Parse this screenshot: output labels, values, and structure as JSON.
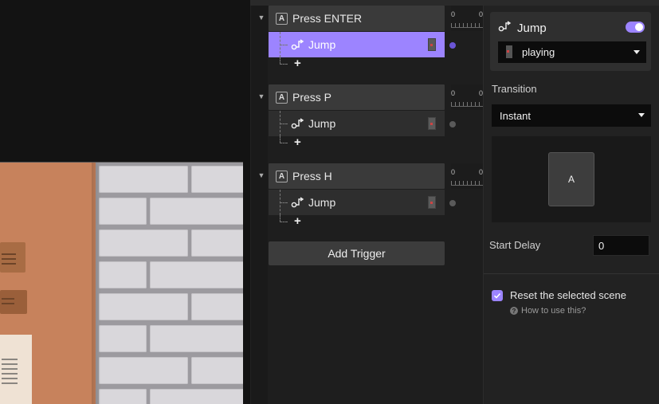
{
  "triggers": [
    {
      "key_badge": "A",
      "title": "Press ENTER",
      "tick_start": "0",
      "tick_next": "0",
      "action": {
        "label": "Jump",
        "selected": true
      },
      "add_label": "+"
    },
    {
      "key_badge": "A",
      "title": "Press P",
      "tick_start": "0",
      "tick_next": "0",
      "action": {
        "label": "Jump",
        "selected": false
      },
      "add_label": "+"
    },
    {
      "key_badge": "A",
      "title": "Press H",
      "tick_start": "0",
      "tick_next": "0",
      "action": {
        "label": "Jump",
        "selected": false
      },
      "add_label": "+"
    }
  ],
  "add_trigger_label": "Add Trigger",
  "properties": {
    "action_title": "Jump",
    "enabled": true,
    "state_value": "playing",
    "transition_label": "Transition",
    "transition_value": "Instant",
    "preview_letter": "A",
    "start_delay_label": "Start Delay",
    "start_delay_value": "0",
    "reset_label": "Reset the selected scene",
    "reset_checked": true,
    "help_link": "How to use this?"
  },
  "colors": {
    "accent": "#9c84ff",
    "active_dot": "#6b55d6"
  }
}
